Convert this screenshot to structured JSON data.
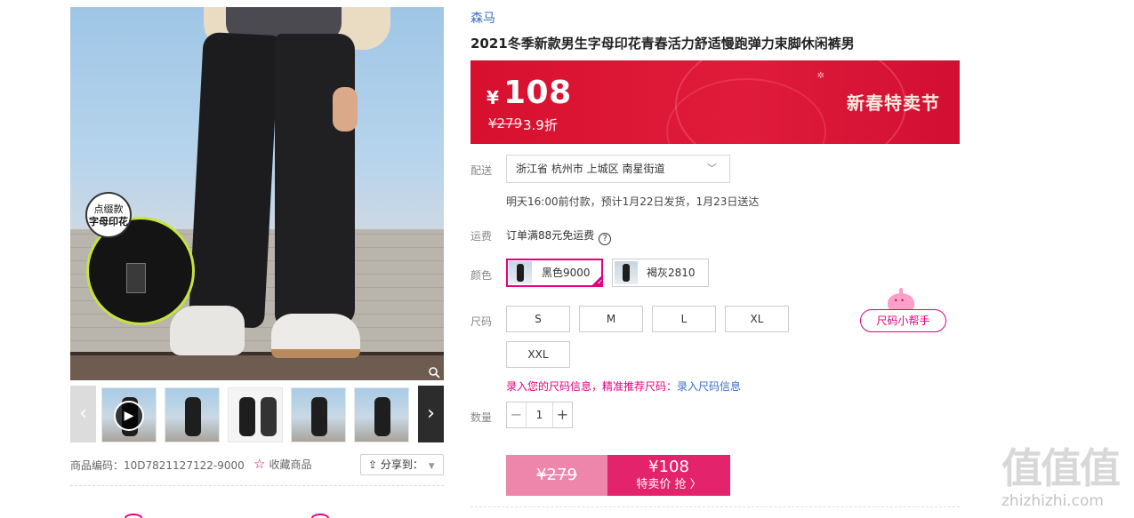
{
  "gallery": {
    "detail_bubble_line1": "点缀款",
    "detail_bubble_line2": "字母印花",
    "zoom_icon": "magnifier-icon",
    "prev_icon": "‹",
    "next_icon": "›",
    "thumbnails": [
      {
        "kind": "video"
      },
      {
        "kind": "photo"
      },
      {
        "kind": "photo-white"
      },
      {
        "kind": "photo"
      },
      {
        "kind": "photo"
      }
    ]
  },
  "meta": {
    "product_code": "商品编码：10D7821127122-9000",
    "favorite_label": "收藏商品",
    "share_label": "分享到："
  },
  "product": {
    "brand": "森马",
    "title": "2021冬季新款男生字母印花青春活力舒适慢跑弹力束脚休闲裤男"
  },
  "price": {
    "currency": "¥",
    "current": "108",
    "original": "¥279",
    "discount": "3.9折",
    "promo": "新春特卖节"
  },
  "delivery": {
    "label": "配送",
    "location": "浙江省 杭州市 上城区 南星街道",
    "eta": "明天16:00前付款，预计1月22日发货，1月23日送达"
  },
  "shipping": {
    "label": "运费",
    "text": "订单满88元免运费"
  },
  "color": {
    "label": "颜色",
    "options": [
      {
        "name": "黑色9000",
        "selected": true
      },
      {
        "name": "褐灰2810",
        "selected": false
      }
    ]
  },
  "size": {
    "label": "尺码",
    "options": [
      "S",
      "M",
      "L",
      "XL",
      "XXL"
    ],
    "helper_label": "尺码小帮手",
    "tip_text": "录入您的尺码信息，精准推荐尺码：",
    "tip_link": "录入尺码信息"
  },
  "quantity": {
    "label": "数量",
    "value": "1",
    "minus": "−",
    "plus": "+"
  },
  "buy": {
    "original_price": "¥279",
    "sale_price": "¥108",
    "sale_label": "特卖价 抢 〉"
  },
  "watermark": {
    "big": "值值值",
    "small": "zhizhizhi.com"
  },
  "colors": {
    "accent": "#e4007f",
    "banner_red": "#d8102f",
    "buy_pink": "#e3236b",
    "buy_light": "#ee86ab",
    "link_blue": "#3a6fc4"
  }
}
